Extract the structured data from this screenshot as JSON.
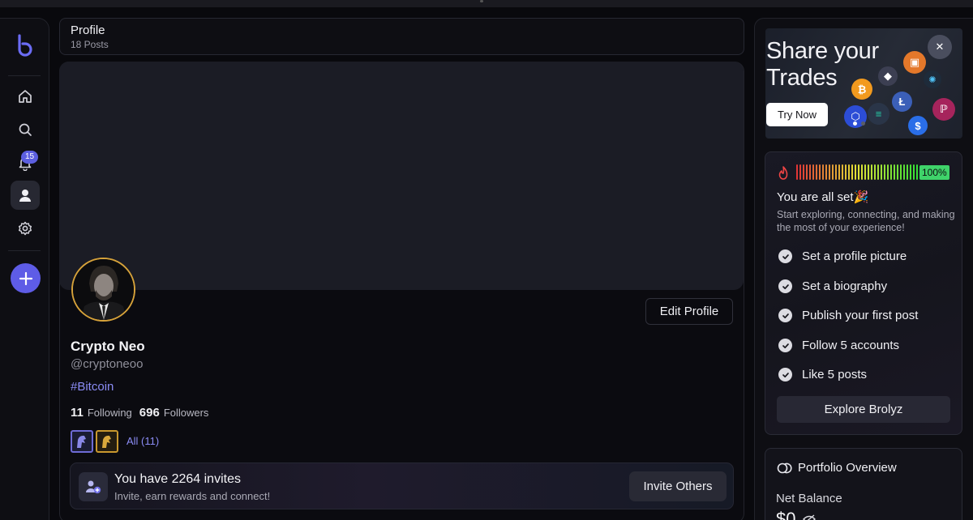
{
  "rail": {
    "logo": "brolyz-logo",
    "nav": [
      {
        "name": "home",
        "icon": "home-icon"
      },
      {
        "name": "search",
        "icon": "search-icon"
      },
      {
        "name": "notifications",
        "icon": "bell-icon",
        "badge": "15"
      },
      {
        "name": "profile",
        "icon": "user-icon",
        "active": true
      },
      {
        "name": "settings",
        "icon": "gear-icon"
      }
    ],
    "create_icon": "plus-icon"
  },
  "profile_header": {
    "title": "Profile",
    "subtitle": "18 Posts"
  },
  "profile": {
    "name": "Crypto Neo",
    "handle": "@cryptoneoo",
    "tag": "#Bitcoin",
    "following_count": "11",
    "following_label": "Following",
    "followers_count": "696",
    "followers_label": "Followers",
    "badges_link": "All (11)",
    "edit_button": "Edit Profile"
  },
  "invite": {
    "title": "You have 2264 invites",
    "subtitle": "Invite, earn rewards and connect!",
    "button": "Invite Others"
  },
  "promo": {
    "title_line1": "Share your",
    "title_line2": "Trades",
    "button": "Try Now"
  },
  "setup": {
    "progress": "100%",
    "heading": "You are all set🎉",
    "description": "Start exploring, connecting, and making the most of your experience!",
    "items": [
      "Set a profile picture",
      "Set a biography",
      "Publish your first post",
      "Follow 5 accounts",
      "Like 5 posts"
    ],
    "button": "Explore Brolyz"
  },
  "portfolio": {
    "title": "Portfolio Overview",
    "net_balance_label": "Net Balance",
    "net_balance_value": "$0"
  },
  "colors": {
    "accent": "#5e5ce6",
    "link": "#8b8cf5",
    "success": "#3fd36a",
    "avatar_ring": "#d6a23a"
  }
}
